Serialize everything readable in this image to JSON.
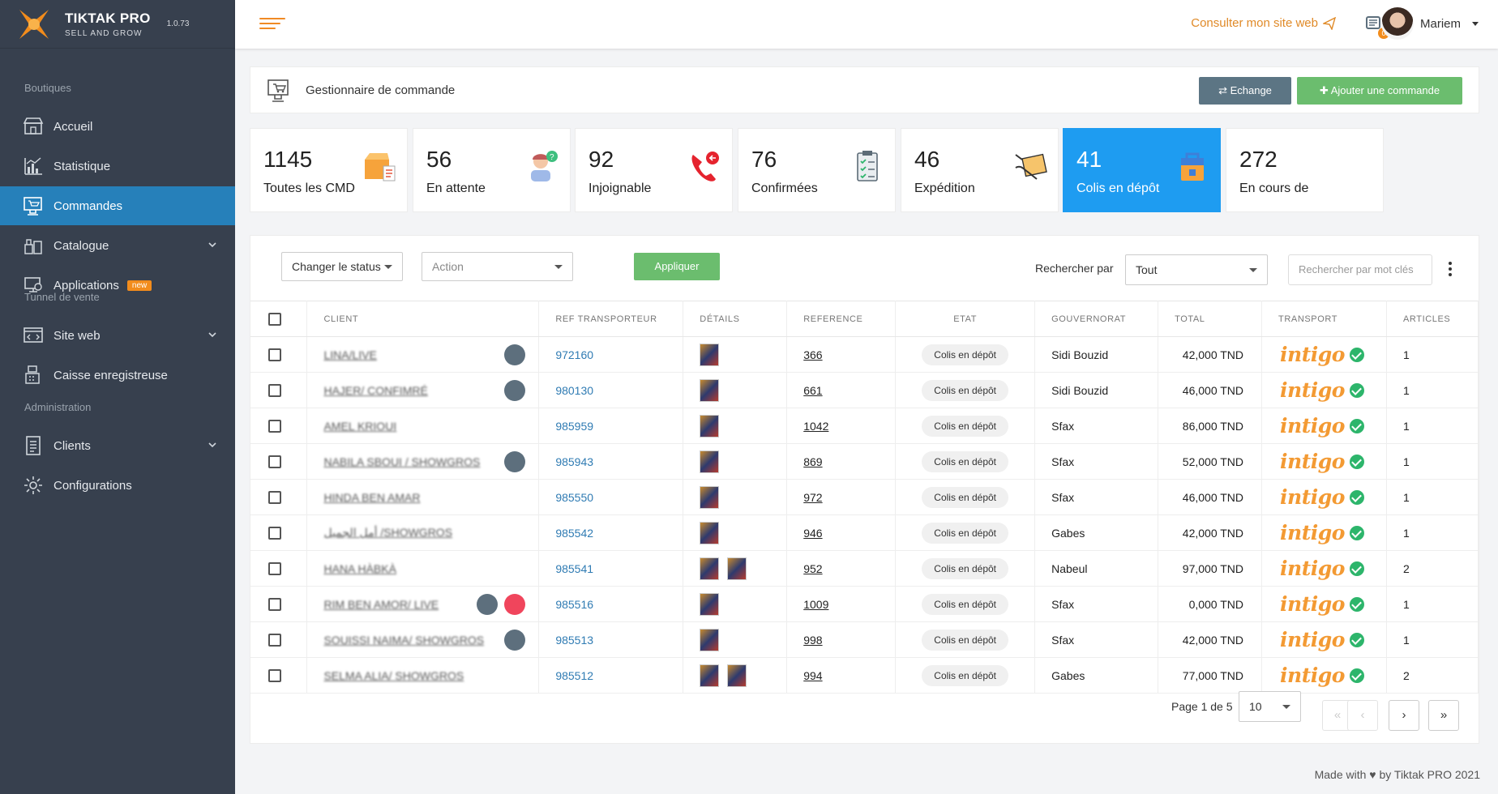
{
  "brand": {
    "name": "TIKTAK PRO",
    "tagline": "SELL AND GROW",
    "version": "1.0.73"
  },
  "sidebar": {
    "sections": [
      {
        "title": "Boutiques",
        "items": [
          {
            "label": "Accueil",
            "icon": "store-icon"
          },
          {
            "label": "Statistique",
            "icon": "chart-icon"
          },
          {
            "label": "Commandes",
            "icon": "orders-icon",
            "active": true
          },
          {
            "label": "Catalogue",
            "icon": "catalog-icon",
            "expandable": true
          },
          {
            "label": "Applications",
            "icon": "apps-icon",
            "badge": "new"
          }
        ]
      },
      {
        "title": "Tunnel de vente",
        "items": [
          {
            "label": "Site web",
            "icon": "website-icon",
            "expandable": true
          },
          {
            "label": "Caisse enregistreuse",
            "icon": "cash-register-icon"
          }
        ]
      },
      {
        "title": "Administration",
        "items": [
          {
            "label": "Clients",
            "icon": "clients-icon",
            "expandable": true
          },
          {
            "label": "Configurations",
            "icon": "settings-icon"
          }
        ]
      }
    ]
  },
  "topbar": {
    "site_link": "Consulter mon site web",
    "notif_count": "0",
    "user": "Mariem"
  },
  "header": {
    "title": "Gestionnaire de commande",
    "btn_exchange": "Echange",
    "btn_add": "Ajouter une commande"
  },
  "stats": [
    {
      "value": "1145",
      "label": "Toutes les CMD",
      "icon": "box-icon"
    },
    {
      "value": "56",
      "label": "En attente",
      "icon": "waiting-agent-icon"
    },
    {
      "value": "92",
      "label": "Injoignable",
      "icon": "phone-missed-icon"
    },
    {
      "value": "76",
      "label": "Confirmées",
      "icon": "clipboard-check-icon"
    },
    {
      "value": "46",
      "label": "Expédition",
      "icon": "delivery-box-icon"
    },
    {
      "value": "41",
      "label": "Colis en dépôt",
      "icon": "shopping-bag-icon",
      "active": true
    },
    {
      "value": "272",
      "label": "En cours de",
      "icon": "truck-icon"
    }
  ],
  "filters": {
    "status_select": "Changer le status",
    "action_select": "Action",
    "apply": "Appliquer",
    "search_by_label": "Rechercher par",
    "search_by_value": "Tout",
    "search_placeholder": "Rechercher par mot clés"
  },
  "table": {
    "columns": [
      "Client",
      "Ref transporteur",
      "Détails",
      "Reference",
      "Etat",
      "Gouvernorat",
      "Total",
      "Transport",
      "Articles"
    ],
    "rows": [
      {
        "client": "LINA/LIVE",
        "ref": "972160",
        "reference": "366",
        "etat": "Colis en dépôt",
        "gouv": "Sidi Bouzid",
        "total": "42,000 TND",
        "transport": "intigo",
        "articles": "1",
        "thumbs": 1,
        "chat": true,
        "exchange": false
      },
      {
        "client": "HAJER/ CONFIMRÉ",
        "ref": "980130",
        "reference": "661",
        "etat": "Colis en dépôt",
        "gouv": "Sidi Bouzid",
        "total": "46,000 TND",
        "transport": "intigo",
        "articles": "1",
        "thumbs": 1,
        "chat": true,
        "exchange": false
      },
      {
        "client": "AMEL KRIOUI",
        "ref": "985959",
        "reference": "1042",
        "etat": "Colis en dépôt",
        "gouv": "Sfax",
        "total": "86,000 TND",
        "transport": "intigo",
        "articles": "1",
        "thumbs": 1,
        "chat": false,
        "exchange": false
      },
      {
        "client": "NABILA SBOUI / SHOWGROS",
        "ref": "985943",
        "reference": "869",
        "etat": "Colis en dépôt",
        "gouv": "Sfax",
        "total": "52,000 TND",
        "transport": "intigo",
        "articles": "1",
        "thumbs": 1,
        "chat": true,
        "exchange": false
      },
      {
        "client": "HINDA BEN AMAR",
        "ref": "985550",
        "reference": "972",
        "etat": "Colis en dépôt",
        "gouv": "Sfax",
        "total": "46,000 TND",
        "transport": "intigo",
        "articles": "1",
        "thumbs": 1,
        "chat": false,
        "exchange": false
      },
      {
        "client": "أمل الجميل /SHOWGROS",
        "ref": "985542",
        "reference": "946",
        "etat": "Colis en dépôt",
        "gouv": "Gabes",
        "total": "42,000 TND",
        "transport": "intigo",
        "articles": "1",
        "thumbs": 1,
        "chat": false,
        "exchange": false
      },
      {
        "client": "HANA HÀBKÀ",
        "ref": "985541",
        "reference": "952",
        "etat": "Colis en dépôt",
        "gouv": "Nabeul",
        "total": "97,000 TND",
        "transport": "intigo",
        "articles": "2",
        "thumbs": 2,
        "chat": false,
        "exchange": false
      },
      {
        "client": "RIM BEN AMOR/ LIVE",
        "ref": "985516",
        "reference": "1009",
        "etat": "Colis en dépôt",
        "gouv": "Sfax",
        "total": "0,000 TND",
        "transport": "intigo",
        "articles": "1",
        "thumbs": 1,
        "chat": true,
        "exchange": true
      },
      {
        "client": "SOUISSI NAIMA/ SHOWGROS",
        "ref": "985513",
        "reference": "998",
        "etat": "Colis en dépôt",
        "gouv": "Sfax",
        "total": "42,000 TND",
        "transport": "intigo",
        "articles": "1",
        "thumbs": 1,
        "chat": true,
        "exchange": false
      },
      {
        "client": "SELMA ALIA/ SHOWGROS",
        "ref": "985512",
        "reference": "994",
        "etat": "Colis en dépôt",
        "gouv": "Gabes",
        "total": "77,000 TND",
        "transport": "intigo",
        "articles": "2",
        "thumbs": 2,
        "chat": false,
        "exchange": false
      }
    ]
  },
  "pagination": {
    "label": "Page 1 de 5",
    "per_page": "10"
  },
  "footer": {
    "text": "Made with ♥ by Tiktak PRO 2021"
  },
  "colors": {
    "sidebar": "#37404e",
    "active": "#2680ba",
    "accent": "#f28c1c",
    "green": "#6bbd6e",
    "stat_active": "#1e9cf1"
  }
}
